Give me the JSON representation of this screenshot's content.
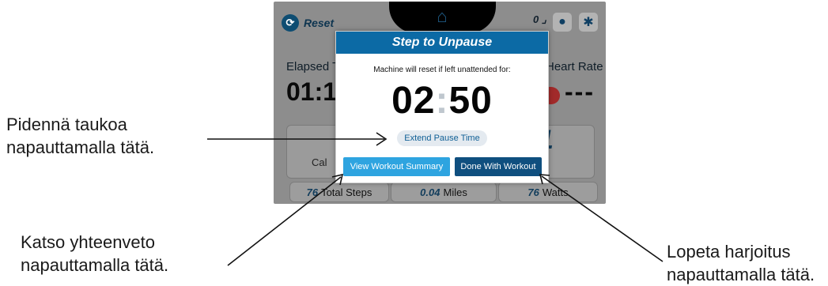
{
  "topbar": {
    "reset_label": "Reset",
    "steps_count": "0",
    "icons": [
      "reset-icon",
      "home-icon",
      "user-icon",
      "gear-icon"
    ]
  },
  "background": {
    "elapsed_label": "Elapsed Ti",
    "elapsed_value": "01:1",
    "heart_label": "Heart Rate",
    "heart_value": "---",
    "card_left_label": "Cal",
    "card_right_big": "1",
    "card_right_label": "ts",
    "total_steps_value": "76",
    "total_steps_label": "Total Steps",
    "miles_value": "0.04",
    "miles_label": "Miles",
    "watts_value": "76",
    "watts_label": "Watts"
  },
  "modal": {
    "title": "Step to Unpause",
    "subtitle": "Machine will reset if left unattended for:",
    "minutes": "02",
    "separator": ":",
    "seconds": "50",
    "extend_label": "Extend Pause Time",
    "summary_label": "View Workout Summary",
    "done_label": "Done With Workout"
  },
  "annotations": {
    "extend": [
      "Pidennä taukoa",
      "napauttamalla tätä."
    ],
    "summary": [
      "Katso yhteenveto",
      "napauttamalla tätä."
    ],
    "done": [
      "Lopeta harjoitus",
      "napauttamalla tätä."
    ]
  },
  "colors": {
    "header_blue": "#0c6aa5",
    "summary_button": "#2ea4e0",
    "done_button": "#0f4f7f",
    "overlay_gray": "#8d8d8d"
  }
}
